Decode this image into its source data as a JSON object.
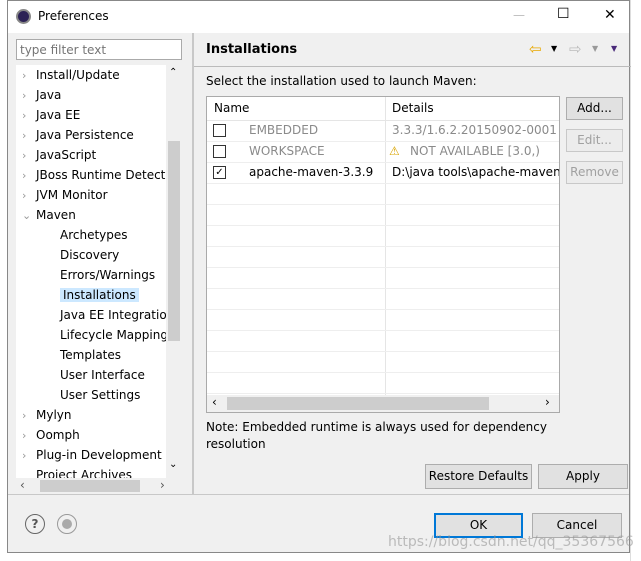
{
  "window": {
    "title": "Preferences",
    "minimize": "—",
    "maximize": "☐",
    "close": "✕"
  },
  "filter": {
    "placeholder": "type filter text"
  },
  "tree": {
    "top": [
      {
        "label": "Install/Update"
      },
      {
        "label": "Java"
      },
      {
        "label": "Java EE"
      },
      {
        "label": "Java Persistence"
      },
      {
        "label": "JavaScript"
      },
      {
        "label": "JBoss Runtime Detect"
      },
      {
        "label": "JVM Monitor"
      },
      {
        "label": "Maven"
      }
    ],
    "maven_children": [
      "Archetypes",
      "Discovery",
      "Errors/Warnings",
      "Installations",
      "Java EE Integration",
      "Lifecycle Mapping",
      "Templates",
      "User Interface",
      "User Settings"
    ],
    "selected": "Installations",
    "bottom": [
      {
        "label": "Mylyn"
      },
      {
        "label": "Oomph"
      },
      {
        "label": "Plug-in Development"
      },
      {
        "label": "Project Archives"
      }
    ]
  },
  "page": {
    "title": "Installations",
    "intro": "Select the installation used to launch Maven:",
    "columns": [
      "Name",
      "Details"
    ],
    "rows": [
      {
        "name": "EMBEDDED",
        "details": "3.3.3/1.6.2.20150902-0001",
        "checked": false,
        "disabled": true,
        "warning": false
      },
      {
        "name": "WORKSPACE",
        "details": "NOT AVAILABLE [3.0,)",
        "checked": false,
        "disabled": true,
        "warning": true
      },
      {
        "name": "apache-maven-3.3.9",
        "details": "D:\\java tools\\apache-maven-",
        "checked": true,
        "disabled": false,
        "warning": false
      }
    ],
    "buttons": {
      "add": "Add...",
      "edit": "Edit...",
      "remove": "Remove"
    },
    "note": "Note: Embedded runtime is always used for dependency resolution",
    "restore": "Restore Defaults",
    "apply": "Apply"
  },
  "footer": {
    "ok": "OK",
    "cancel": "Cancel"
  },
  "watermark": "https://blog.csdn.net/qq_35367566",
  "colors": {
    "selection": "#cce8ff",
    "accent": "#0078d7",
    "back_arrow": "#e8a800"
  }
}
